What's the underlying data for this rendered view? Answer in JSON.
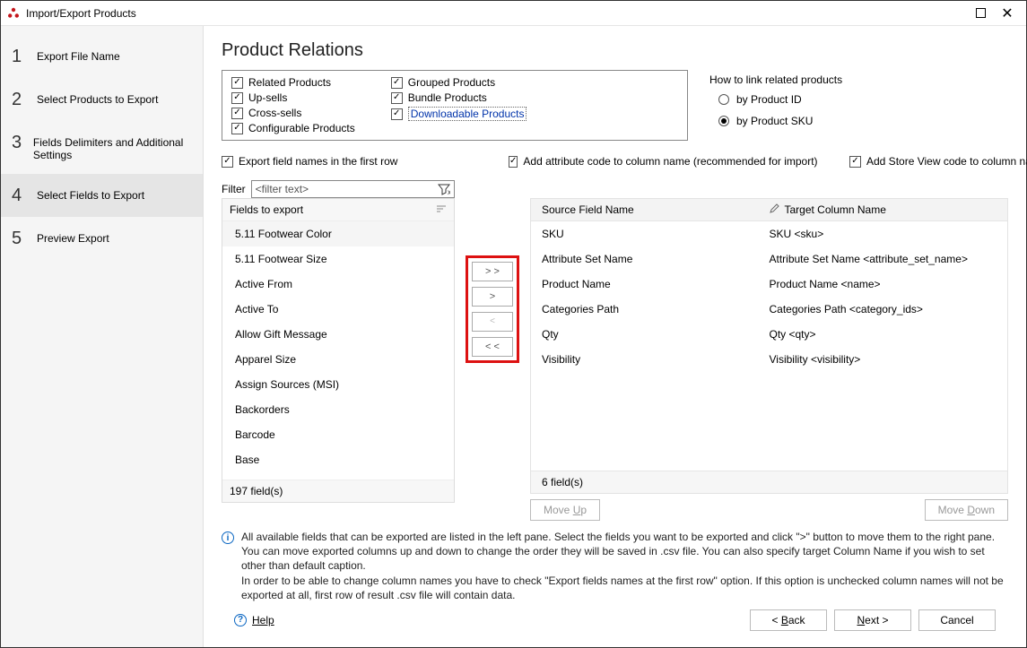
{
  "window": {
    "title": "Import/Export Products"
  },
  "sidebar": {
    "steps": [
      {
        "num": "1",
        "label": "Export File Name"
      },
      {
        "num": "2",
        "label": "Select Products to Export"
      },
      {
        "num": "3",
        "label": "Fields Delimiters and Additional Settings"
      },
      {
        "num": "4",
        "label": "Select Fields to Export"
      },
      {
        "num": "5",
        "label": "Preview Export"
      }
    ],
    "selected_index": 3
  },
  "main": {
    "heading": "Product Relations",
    "relations": {
      "col1": [
        "Related Products",
        "Up-sells",
        "Cross-sells",
        "Configurable Products"
      ],
      "col2": [
        "Grouped Products",
        "Bundle Products",
        "Downloadable Products"
      ],
      "focused": "Downloadable Products"
    },
    "link_options": {
      "label": "How to link related products",
      "options": [
        "by Product ID",
        "by Product SKU"
      ],
      "selected_index": 1
    },
    "row_checks": {
      "export_field_names": "Export field names in the  first row",
      "add_attr_code": "Add attribute code to column name (recommended for import)",
      "add_store_view": "Add Store View code to column nam"
    },
    "filter": {
      "label": "Filter",
      "placeholder": "<filter text>"
    },
    "left_list": {
      "header": "Fields to export",
      "items": [
        "5.11 Footwear Color",
        "5.11 Footwear Size",
        "Active From",
        "Active To",
        "Allow Gift Message",
        "Apparel Size",
        "Assign Sources (MSI)",
        "Backorders",
        "Barcode",
        "Base"
      ],
      "selected_index": 0,
      "footer": "197 field(s)"
    },
    "xfer": {
      "add_all": "> >",
      "add": ">",
      "remove": "<",
      "remove_all": "< <"
    },
    "right_table": {
      "headers": {
        "source": "Source Field Name",
        "target": "Target Column Name"
      },
      "rows": [
        {
          "source": "SKU",
          "target": "SKU <sku>"
        },
        {
          "source": "Attribute Set Name",
          "target": "Attribute Set Name <attribute_set_name>"
        },
        {
          "source": "Product Name",
          "target": "Product Name <name>"
        },
        {
          "source": "Categories Path",
          "target": "Categories Path <category_ids>"
        },
        {
          "source": "Qty",
          "target": "Qty <qty>"
        },
        {
          "source": "Visibility",
          "target": "Visibility <visibility>"
        }
      ],
      "footer": "6 field(s)",
      "move_up": "Move Up",
      "move_down": "Move Down"
    },
    "info": {
      "text1": "All available fields that can be exported are listed in the left pane. Select the fields you want to be exported and click \">\" button to move them to the right pane. You can move exported columns up and down to change the order they will be saved in .csv file. You can also specify target Column Name if you wish to set other than default caption.",
      "text2": "In order to be able to change column names you have to check \"Export fields names at the first row\" option. If this option is unchecked column names will not be exported at all, first row of result .csv file will contain data."
    }
  },
  "footer": {
    "help": "Help",
    "back": "< Back",
    "next": "Next >",
    "cancel": "Cancel"
  }
}
